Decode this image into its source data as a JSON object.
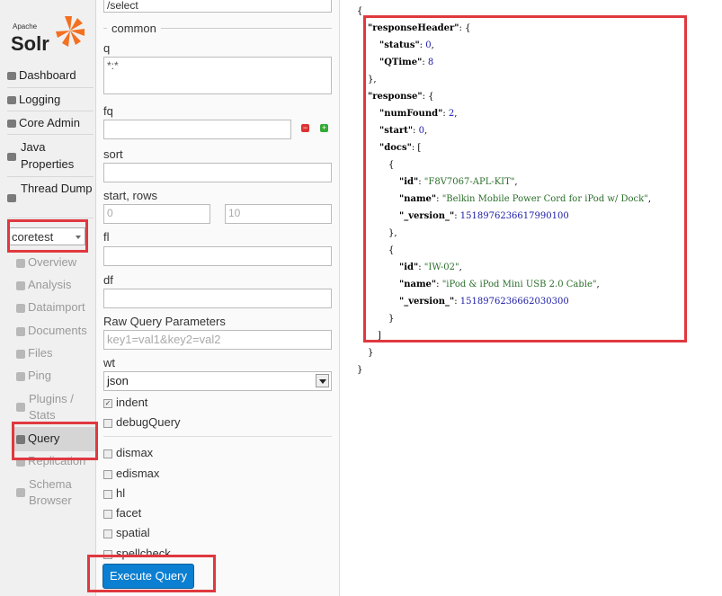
{
  "logo": {
    "apache": "Apache",
    "solr": "Solr"
  },
  "nav": {
    "items": [
      "Dashboard",
      "Logging",
      "Core Admin",
      "Java Properties",
      "Thread Dump"
    ],
    "core_selector": "coretest",
    "core_items": [
      "Overview",
      "Analysis",
      "Dataimport",
      "Documents",
      "Files",
      "Ping",
      "Plugins / Stats",
      "Query",
      "Replication",
      "Schema Browser"
    ]
  },
  "form": {
    "handler_value": "/select",
    "common_legend": "common",
    "q_label": "q",
    "q_value": "*:*",
    "fq_label": "fq",
    "sort_label": "sort",
    "start_rows_label": "start, rows",
    "start_value": "0",
    "rows_value": "10",
    "fl_label": "fl",
    "df_label": "df",
    "raw_label": "Raw Query Parameters",
    "raw_placeholder": "key1=val1&key2=val2",
    "wt_label": "wt",
    "wt_value": "json",
    "checkboxes": [
      {
        "label": "indent",
        "checked": true
      },
      {
        "label": "debugQuery",
        "checked": false
      },
      {
        "label": "dismax",
        "checked": false
      },
      {
        "label": "edismax",
        "checked": false
      },
      {
        "label": "hl",
        "checked": false
      },
      {
        "label": "facet",
        "checked": false
      },
      {
        "label": "spatial",
        "checked": false
      },
      {
        "label": "spellcheck",
        "checked": false
      }
    ],
    "execute_label": "Execute Query"
  },
  "response": {
    "status": "0",
    "qtime": "8",
    "num_found": "2",
    "start": "0",
    "docs": [
      {
        "id": "F8V7067-APL-KIT",
        "name": "Belkin Mobile Power Cord for iPod w/ Dock",
        "version": "1518976236617990100"
      },
      {
        "id": "IW-02",
        "name": "iPod & iPod Mini USB 2.0 Cable",
        "version": "1518976236662030300"
      }
    ]
  },
  "colors": {
    "highlight": "#e0383f",
    "button": "#0b7fd1",
    "number": "#1a1aa6"
  }
}
